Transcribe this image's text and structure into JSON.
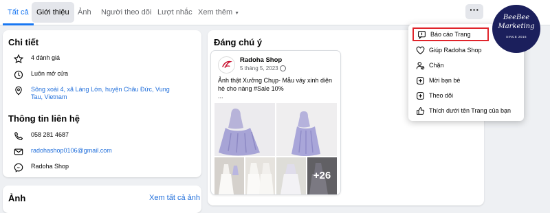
{
  "tabs": [
    {
      "label": "Tất cả"
    },
    {
      "label": "Giới thiệu"
    },
    {
      "label": "Ảnh"
    },
    {
      "label": "Người theo dõi"
    },
    {
      "label": "Lượt nhắc"
    },
    {
      "label": "Xem thêm"
    }
  ],
  "more_button": "···",
  "details": {
    "title": "Chi tiết",
    "rating": "4 đánh giá",
    "hours": "Luôn mở cửa",
    "address": "Sông xoài 4, xã Láng Lớn, huyện Châu Đức, Vung Tau, Vietnam"
  },
  "contact": {
    "title": "Thông tin liên hệ",
    "phone": "058 281 4687",
    "email": "radohashop0106@gmail.com",
    "messenger": "Radoha Shop"
  },
  "photos": {
    "title": "Ảnh",
    "see_all": "Xem tất cả ảnh"
  },
  "featured": {
    "title": "Đáng chú ý",
    "post": {
      "author": "Radoha Shop",
      "date": "5 tháng 5, 2023",
      "text": "Ảnh thật Xưởng Chụp- Mẫu váy xinh diện hè cho nàng #Sale 10%",
      "ellipsis": "...",
      "more_count": "+26"
    }
  },
  "menu": {
    "items": [
      {
        "label": "Báo cáo Trang",
        "icon": "report-flag-icon"
      },
      {
        "label": "Giúp Radoha Shop",
        "icon": "heart-icon"
      },
      {
        "label": "Chặn",
        "icon": "block-user-icon"
      },
      {
        "label": "Mời bạn bè",
        "icon": "invite-plus-icon"
      },
      {
        "label": "Theo dõi",
        "icon": "follow-plus-icon"
      },
      {
        "label": "Thích dưới tên Trang của bạn",
        "icon": "like-icon"
      }
    ],
    "highlight_color": "#e0242b"
  },
  "logo": {
    "line1": "BeeBee",
    "line2": "Marketing",
    "line3": "SINCE 2016"
  },
  "colors": {
    "accent": "#1877f2",
    "logo_bg": "#1b1f5c"
  }
}
